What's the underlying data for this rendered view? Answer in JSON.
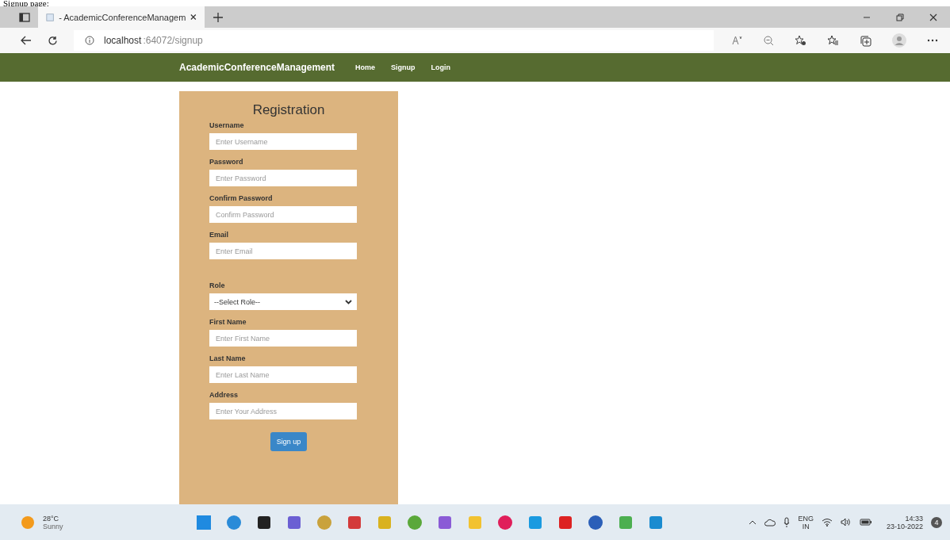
{
  "caption": "Signup page:",
  "browser": {
    "tab_title": "- AcademicConferenceManagem",
    "url_host": "localhost",
    "url_rest": ":64072/signup"
  },
  "navbar": {
    "brand": "AcademicConferenceManagement",
    "links": [
      "Home",
      "Signup",
      "Login"
    ]
  },
  "form": {
    "title": "Registration",
    "fields": [
      {
        "kind": "text",
        "label": "Username",
        "placeholder": "Enter Username"
      },
      {
        "kind": "text",
        "label": "Password",
        "placeholder": "Enter Password"
      },
      {
        "kind": "text",
        "label": "Confirm Password",
        "placeholder": "Confirm Password"
      },
      {
        "kind": "text",
        "label": "Email",
        "placeholder": "Enter Email"
      },
      {
        "kind": "select",
        "label": "Role",
        "value": "--Select Role--"
      },
      {
        "kind": "text",
        "label": "First Name",
        "placeholder": "Enter First Name"
      },
      {
        "kind": "text",
        "label": "Last Name",
        "placeholder": "Enter Last Name"
      },
      {
        "kind": "text",
        "label": "Address",
        "placeholder": "Enter Your Address"
      }
    ],
    "submit": "Sign up"
  },
  "taskbar": {
    "temperature": "28°C",
    "weather": "Sunny",
    "language": "ENG",
    "region": "IN",
    "time": "14:33",
    "date": "23-10-2022",
    "notifications": "4"
  }
}
